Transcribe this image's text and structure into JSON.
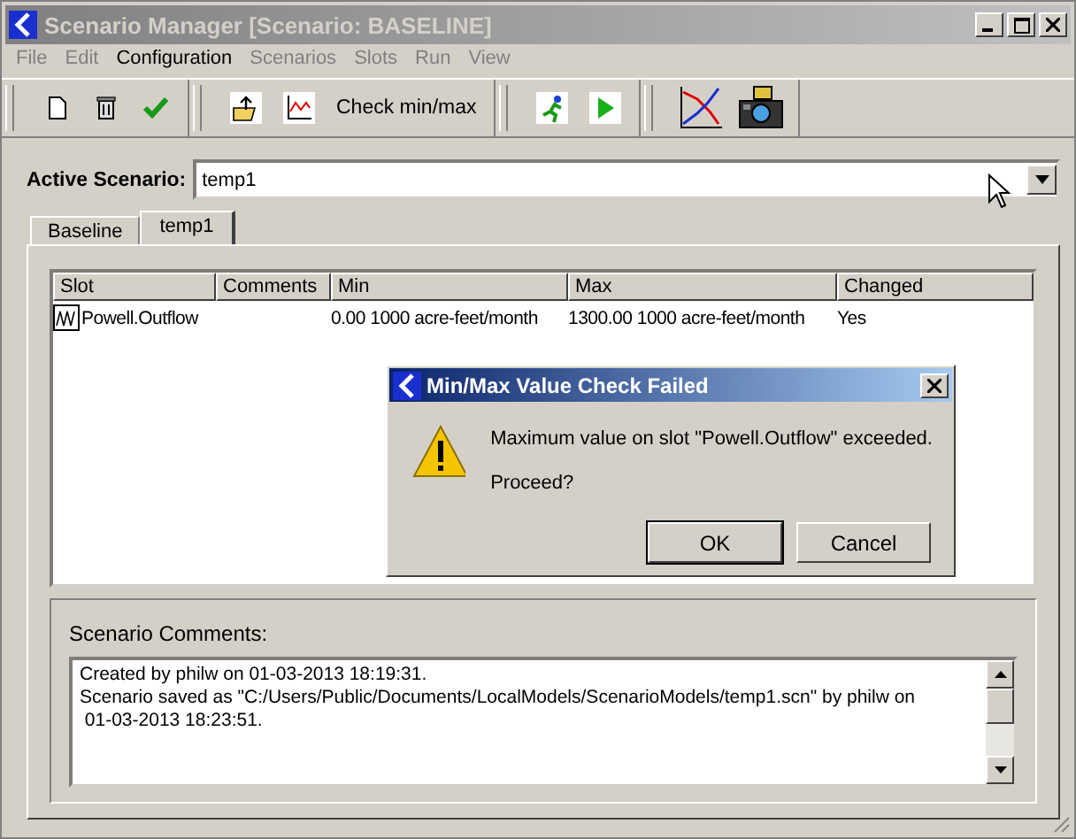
{
  "window": {
    "title": "Scenario Manager [Scenario: BASELINE]"
  },
  "menu": [
    {
      "label": "File",
      "disabled": true
    },
    {
      "label": "Edit",
      "disabled": true
    },
    {
      "label": "Configuration",
      "disabled": false
    },
    {
      "label": "Scenarios",
      "disabled": true
    },
    {
      "label": "Slots",
      "disabled": true
    },
    {
      "label": "Run",
      "disabled": true
    },
    {
      "label": "View",
      "disabled": true
    }
  ],
  "toolbar": [
    [
      {
        "kind": "new"
      },
      {
        "kind": "delete"
      },
      {
        "kind": "check"
      }
    ],
    [
      {
        "kind": "export"
      },
      {
        "kind": "plot"
      },
      {
        "kind": "text",
        "label": "Check min/max"
      }
    ],
    [
      {
        "kind": "runner"
      },
      {
        "kind": "play"
      }
    ],
    [
      {
        "kind": "lines"
      },
      {
        "kind": "camera"
      }
    ]
  ],
  "active_scenario": {
    "label": "Active Scenario:",
    "value": "temp1"
  },
  "tabs": [
    {
      "label": "Baseline",
      "selected": false
    },
    {
      "label": "temp1",
      "selected": true
    }
  ],
  "table": {
    "columns": [
      "Slot",
      "Comments",
      "Min",
      "Max",
      "Changed"
    ],
    "rows": [
      {
        "slot": "Powell.Outflow",
        "comments": "",
        "min": "0.00 1000 acre-feet/month",
        "max": "1300.00 1000 acre-feet/month",
        "changed": "Yes"
      }
    ]
  },
  "comments": {
    "label": "Scenario Comments:",
    "lines": [
      "Created by philw on 01-03-2013 18:19:31.",
      "Scenario saved as \"C:/Users/Public/Documents/LocalModels/ScenarioModels/temp1.scn\" by philw on",
      " 01-03-2013 18:23:51."
    ]
  },
  "dialog": {
    "title": "Min/Max Value Check Failed",
    "message": "Maximum value on slot \"Powell.Outflow\" exceeded.",
    "question": "Proceed?",
    "buttons": [
      "OK",
      "Cancel"
    ]
  }
}
